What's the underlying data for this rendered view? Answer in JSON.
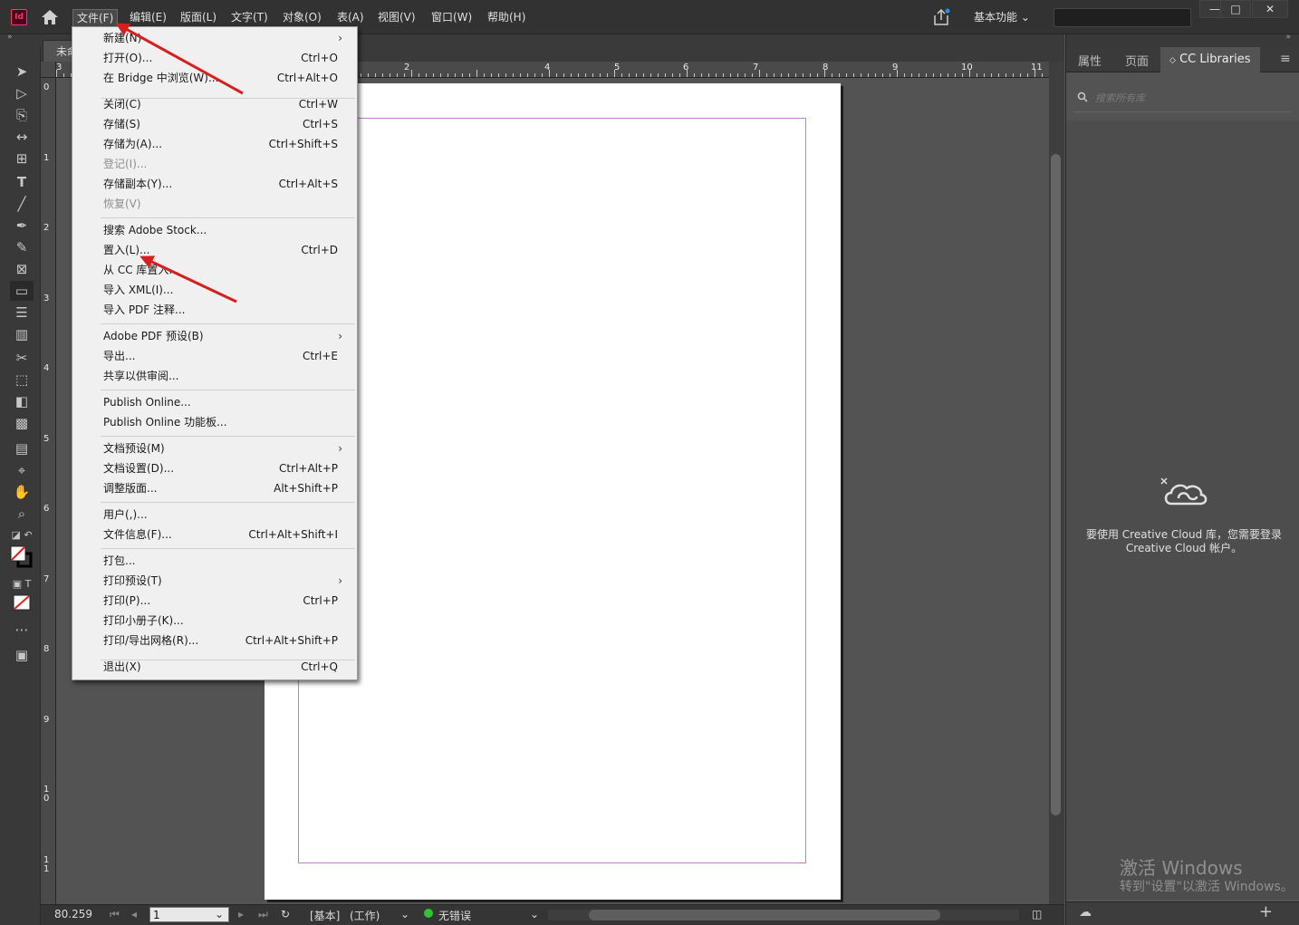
{
  "menubar": {
    "app_icon": "Id",
    "items": [
      "文件(F)",
      "编辑(E)",
      "版面(L)",
      "文字(T)",
      "对象(O)",
      "表(A)",
      "视图(V)",
      "窗口(W)",
      "帮助(H)"
    ],
    "workspace": "基本功能",
    "window_buttons": [
      "—",
      "□",
      "✕"
    ]
  },
  "doc_tab": "未命",
  "ruler_h": [
    "3",
    "2",
    "4",
    "5",
    "6",
    "7",
    "8",
    "9",
    "10",
    "11"
  ],
  "ruler_v": [
    "0",
    "1",
    "2",
    "3",
    "4",
    "5",
    "6",
    "7",
    "8",
    "9",
    "10",
    "11"
  ],
  "file_menu": {
    "items": [
      {
        "label": "新建(N)",
        "shortcut": "",
        "arrow": "›"
      },
      {
        "label": "打开(O)...",
        "shortcut": "Ctrl+O"
      },
      {
        "label": "在 Bridge 中浏览(W)...",
        "shortcut": "Ctrl+Alt+O"
      },
      {
        "label": "关闭(C)",
        "shortcut": "Ctrl+W"
      },
      {
        "label": "存储(S)",
        "shortcut": "Ctrl+S"
      },
      {
        "label": "存储为(A)...",
        "shortcut": "Ctrl+Shift+S"
      },
      {
        "label": "登记(I)...",
        "shortcut": ""
      },
      {
        "label": "存储副本(Y)...",
        "shortcut": "Ctrl+Alt+S"
      },
      {
        "label": "恢复(V)",
        "shortcut": ""
      },
      {
        "label": "搜索 Adobe Stock...",
        "shortcut": ""
      },
      {
        "label": "置入(L)...",
        "shortcut": "Ctrl+D"
      },
      {
        "label": "从 CC 库置入...",
        "shortcut": ""
      },
      {
        "label": "导入 XML(I)...",
        "shortcut": ""
      },
      {
        "label": "导入 PDF 注释...",
        "shortcut": ""
      },
      {
        "label": "Adobe PDF 预设(B)",
        "shortcut": "",
        "arrow": "›"
      },
      {
        "label": "导出...",
        "shortcut": "Ctrl+E"
      },
      {
        "label": "共享以供审阅...",
        "shortcut": ""
      },
      {
        "label": "Publish Online...",
        "shortcut": ""
      },
      {
        "label": "Publish Online 功能板...",
        "shortcut": ""
      },
      {
        "label": "文档预设(M)",
        "shortcut": "",
        "arrow": "›"
      },
      {
        "label": "文档设置(D)...",
        "shortcut": "Ctrl+Alt+P"
      },
      {
        "label": "调整版面...",
        "shortcut": "Alt+Shift+P"
      },
      {
        "label": "用户(,)...",
        "shortcut": ""
      },
      {
        "label": "文件信息(F)...",
        "shortcut": "Ctrl+Alt+Shift+I"
      },
      {
        "label": "打包...",
        "shortcut": ""
      },
      {
        "label": "打印预设(T)",
        "shortcut": "",
        "arrow": "›"
      },
      {
        "label": "打印(P)...",
        "shortcut": "Ctrl+P"
      },
      {
        "label": "打印小册子(K)...",
        "shortcut": ""
      },
      {
        "label": "打印/导出网格(R)...",
        "shortcut": "Ctrl+Alt+Shift+P"
      },
      {
        "label": "退出(X)",
        "shortcut": "Ctrl+Q"
      }
    ]
  },
  "statusbar": {
    "zoom": "80.259",
    "page": "1",
    "master": "[基本]",
    "mode": "(工作)",
    "preflight": "无错误"
  },
  "right_panel": {
    "tabs": [
      "属性",
      "页面",
      "CC Libraries"
    ],
    "search_placeholder": "搜索所有库",
    "message": "要使用 Creative Cloud 库，您需要登录 Creative Cloud 帐户。"
  },
  "watermark": {
    "line1": "激活 Windows",
    "line2": "转到\"设置\"以激活 Windows。"
  },
  "colors": {
    "annotation_arrow": "#d62020",
    "margin_guide": "#c67bd1"
  }
}
